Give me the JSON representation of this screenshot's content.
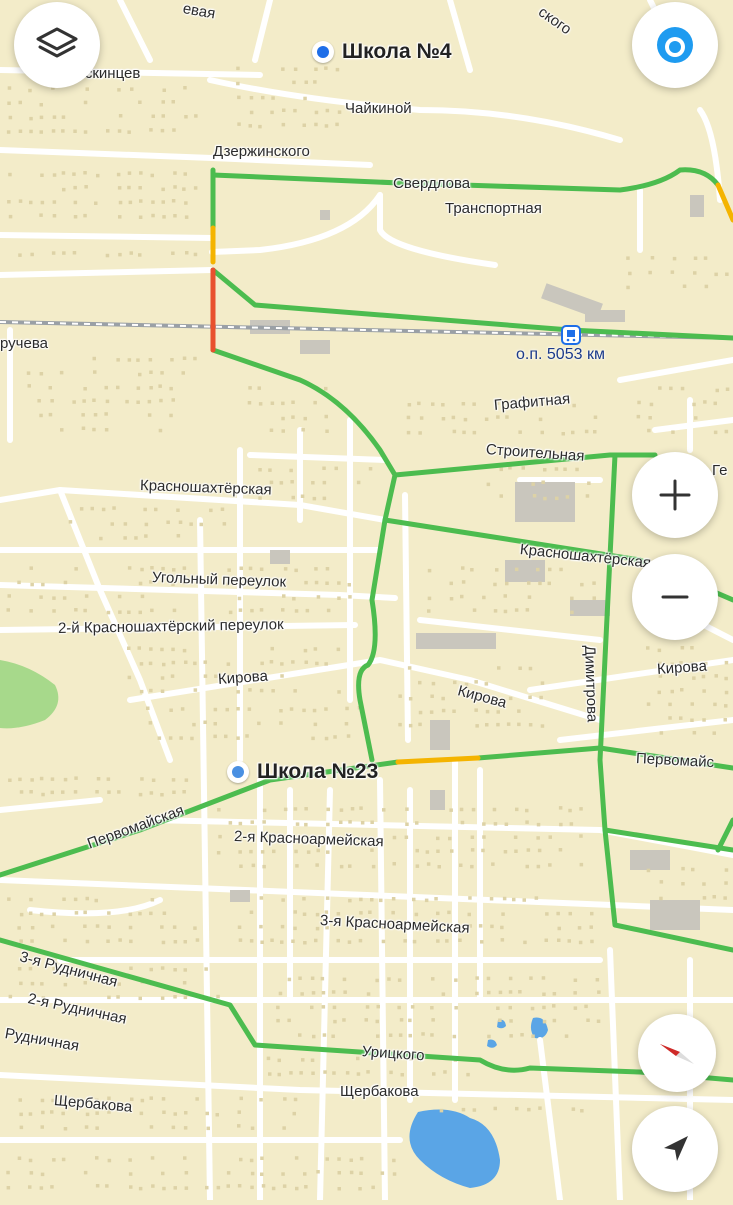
{
  "colors": {
    "land": "#f3ecc9",
    "traffic_free": "#4cbc4f",
    "traffic_medium": "#f4b400",
    "traffic_heavy": "#e8512e",
    "water": "#5aa5e6",
    "park": "#a7d98b",
    "poi_primary": "#1e6ee8",
    "poi_secondary": "#4a90e2",
    "transit": "#1b3a8a",
    "compass_red": "#e53935"
  },
  "pois": [
    {
      "name": "Школа №4",
      "id": "school-4"
    },
    {
      "name": "Школа №23",
      "id": "school-23"
    }
  ],
  "station": {
    "name": "о.п. 5053 км",
    "icon": "train-icon"
  },
  "streets": {
    "top_left_partial": "евая",
    "chelyuskintsev": "елюскинцев",
    "chaikinoy": "Чайкиной",
    "dzerzhinskogo": "Дзержинского",
    "sverdlova": "Свердлова",
    "transportnaya": "Транспортная",
    "top_right_partial": "ского",
    "obruchev_partial": "ручева",
    "grafitnaya": "Графитная",
    "stroitelnaya": "Строительная",
    "ge_partial": "Ге",
    "krasnoshakhterskaya_left": "Красношахтёрская",
    "krasnoshakhterskaya_right": "Красношахтёрская",
    "ugolny": "Угольный переулок",
    "krasnoshakhtersky_2": "2-й Красношахтёрский переулок",
    "kirova_left": "Кирова",
    "kirova_mid": "Кирова",
    "kirova_right": "Кирова",
    "dimitrova": "Димитрова",
    "pervomaiskaya_left": "Первомайская",
    "pervomaiskaya_right": "Первомайс",
    "krasnoarmeyskaya_2": "2-я Красноармейская",
    "krasnoarmeyskaya_3": "3-я Красноармейская",
    "rudnichnaya_3": "3-я Рудничная",
    "rudnichnaya_2": "2-я Рудничная",
    "rudnichnaya": "Рудничная",
    "uritskogo": "Урицкого",
    "shcherbakova_left": "Щербакова",
    "shcherbakova_right": "Щербакова"
  },
  "controls": {
    "layers": "layers-icon",
    "profile": "alice-assistant-icon",
    "zoom_in": "plus-icon",
    "zoom_out": "minus-icon",
    "compass": "compass-icon",
    "location": "navigation-arrow-icon"
  }
}
